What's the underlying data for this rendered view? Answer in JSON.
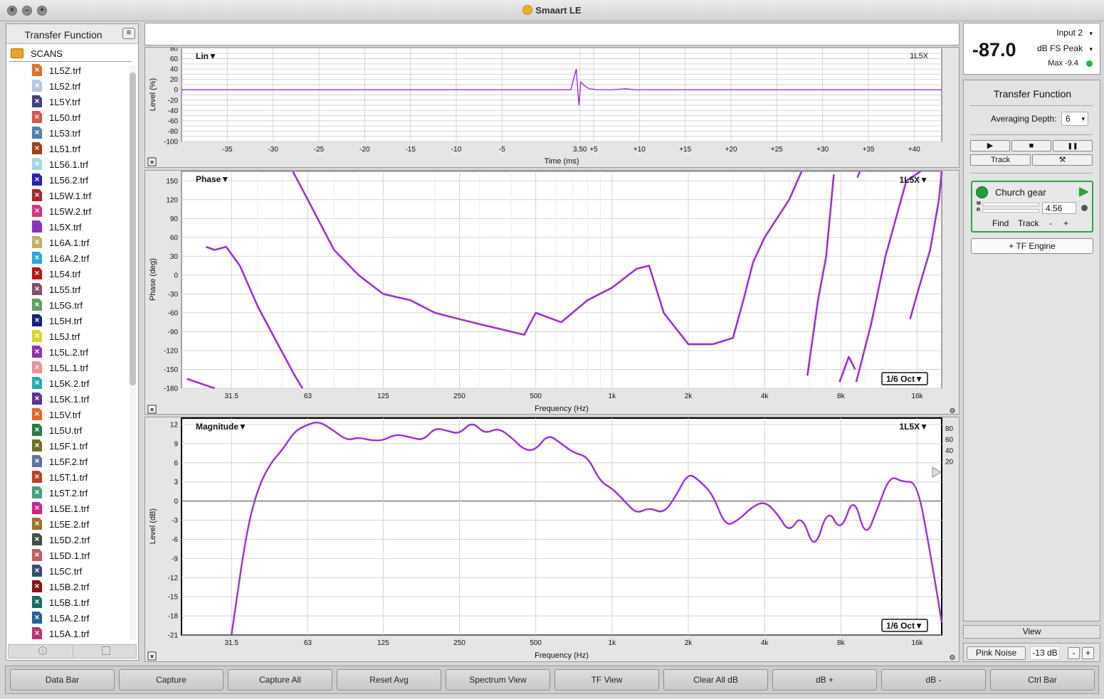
{
  "window": {
    "title": "Smaart LE",
    "close_glyph": "×",
    "minimize_glyph": "–",
    "zoom_glyph": "+"
  },
  "left_panel": {
    "title": "Transfer Function",
    "menu_glyph": "≡",
    "folder": "SCANS",
    "files": [
      {
        "name": "1L5Z.trf",
        "color": "#e07020"
      },
      {
        "name": "1L52.trf",
        "color": "#b8c8e0"
      },
      {
        "name": "1L5Y.trf",
        "color": "#404080"
      },
      {
        "name": "1L50.trf",
        "color": "#e05050"
      },
      {
        "name": "1L53.trf",
        "color": "#5080b0"
      },
      {
        "name": "1L51.trf",
        "color": "#a04010"
      },
      {
        "name": "1L56.1.trf",
        "color": "#a0d8e0"
      },
      {
        "name": "1L56.2.trf",
        "color": "#2020c0"
      },
      {
        "name": "1L5W.1.trf",
        "color": "#b02030"
      },
      {
        "name": "1L5W.2.trf",
        "color": "#e03080"
      },
      {
        "name": "1L5X.trf",
        "color": "#9030c0"
      },
      {
        "name": "1L6A.1.trf",
        "color": "#c0b060"
      },
      {
        "name": "1L6A.2.trf",
        "color": "#20a8e0"
      },
      {
        "name": "1L54.trf",
        "color": "#c01010"
      },
      {
        "name": "1L55.trf",
        "color": "#805070"
      },
      {
        "name": "1L5G.trf",
        "color": "#60a060"
      },
      {
        "name": "1L5H.trf",
        "color": "#102080"
      },
      {
        "name": "1L5J.trf",
        "color": "#d8d820"
      },
      {
        "name": "1L5L.2.trf",
        "color": "#9030b0"
      },
      {
        "name": "1L5L.1.trf",
        "color": "#f09090"
      },
      {
        "name": "1L5K.2.trf",
        "color": "#20b0b0"
      },
      {
        "name": "1L5K.1.trf",
        "color": "#6030a0"
      },
      {
        "name": "1L5V.trf",
        "color": "#f06020"
      },
      {
        "name": "1L5U.trf",
        "color": "#208040"
      },
      {
        "name": "1L5F.1.trf",
        "color": "#707020"
      },
      {
        "name": "1L5F.2.trf",
        "color": "#6070a0"
      },
      {
        "name": "1L5T.1.trf",
        "color": "#c04020"
      },
      {
        "name": "1L5T.2.trf",
        "color": "#40a080"
      },
      {
        "name": "1L5E.1.trf",
        "color": "#d02090"
      },
      {
        "name": "1L5E.2.trf",
        "color": "#a07020"
      },
      {
        "name": "1L5D.2.trf",
        "color": "#405040"
      },
      {
        "name": "1L5D.1.trf",
        "color": "#c06060"
      },
      {
        "name": "1L5C.trf",
        "color": "#305070"
      },
      {
        "name": "1L5B.2.trf",
        "color": "#901010"
      },
      {
        "name": "1L5B.1.trf",
        "color": "#107060"
      },
      {
        "name": "1L5A.2.trf",
        "color": "#2060a0"
      },
      {
        "name": "1L5A.1.trf",
        "color": "#c03070"
      }
    ]
  },
  "colors": {
    "trace": "#9b30d9",
    "plot_bg": "#ffffff",
    "panel_bg": "#e5e5e5",
    "grid": "#d4d4d4",
    "accent_green": "#2da44a"
  },
  "impulse_plot": {
    "header_left": "Lin▼",
    "header_right": "1L5X",
    "ylabel": "Level (%)",
    "xlabel": "Time (ms)",
    "yticks": [
      "80",
      "60",
      "40",
      "20",
      "0",
      "-20",
      "-40",
      "-60",
      "-80",
      "-100"
    ],
    "xticks": [
      "-35",
      "-30",
      "-25",
      "-20",
      "-15",
      "-10",
      "-5",
      "3.50",
      "+5",
      "+10",
      "+15",
      "+20",
      "+25",
      "+30",
      "+35",
      "+40"
    ],
    "close_glyph": "×"
  },
  "phase_plot": {
    "header_left": "Phase▼",
    "header_right": "1L5X▼",
    "ylabel": "Phase (deg)",
    "xlabel": "Frequency (Hz)",
    "yticks": [
      "150",
      "120",
      "90",
      "60",
      "30",
      "0",
      "-30",
      "-60",
      "-90",
      "-120",
      "-150",
      "-180"
    ],
    "xticks": [
      "31.5",
      "63",
      "125",
      "250",
      "500",
      "1k",
      "2k",
      "4k",
      "8k",
      "16k"
    ],
    "smoothing": "1/6 Oct▼",
    "close_glyph": "×",
    "gear_glyph": "⚙"
  },
  "magnitude_plot": {
    "header_left": "Magnitude▼",
    "header_right": "1L5X▼",
    "ylabel": "Level (dB)",
    "xlabel": "Frequency (Hz)",
    "yticks": [
      "12",
      "9",
      "6",
      "3",
      "0",
      "-3",
      "-6",
      "-9",
      "-12",
      "-15",
      "-18",
      "-21"
    ],
    "yticks_right": [
      "80",
      "60",
      "40",
      "20"
    ],
    "xticks": [
      "31.5",
      "63",
      "125",
      "250",
      "500",
      "1k",
      "2k",
      "4k",
      "8k",
      "16k"
    ],
    "smoothing": "1/6 Oct▼",
    "close_glyph": "×",
    "gear_glyph": "⚙"
  },
  "chart_data": [
    {
      "type": "line",
      "title": "Lin",
      "xlabel": "Time (ms)",
      "ylabel": "Level (%)",
      "xlim": [
        -40,
        43
      ],
      "ylim": [
        -100,
        80
      ],
      "series": [
        {
          "name": "1L5X",
          "x": [
            -40,
            -10,
            0,
            2.5,
            2.8,
            3.1,
            3.4,
            3.6,
            4.0,
            4.5,
            5.5,
            7,
            8.5,
            9.5,
            11,
            14,
            20,
            30,
            43
          ],
          "y": [
            0,
            0,
            0,
            0,
            20,
            40,
            -30,
            15,
            8,
            2,
            0,
            0,
            2,
            0,
            0,
            0,
            0,
            0,
            0
          ]
        }
      ]
    },
    {
      "type": "line",
      "title": "Phase",
      "xlabel": "Frequency (Hz)",
      "ylabel": "Phase (deg)",
      "x_scale": "log",
      "ylim": [
        -180,
        165
      ],
      "series": [
        {
          "name": "1L5X",
          "segments": [
            {
              "x": [
                21,
                27
              ],
              "y": [
                -165,
                -180
              ]
            },
            {
              "x": [
                25,
                27,
                30,
                34,
                40,
                48,
                56,
                60
              ],
              "y": [
                45,
                40,
                45,
                15,
                -50,
                -110,
                -160,
                -180
              ]
            },
            {
              "x": [
                55,
                63,
                80,
                100,
                125,
                160,
                200,
                250,
                315,
                400,
                450,
                500,
                630,
                800,
                1000,
                1250,
                1400,
                1600,
                2000,
                2500,
                3000,
                3300,
                3600,
                4000,
                5000,
                5600
              ],
              "y": [
                170,
                120,
                40,
                0,
                -30,
                -40,
                -60,
                -70,
                -80,
                -90,
                -95,
                -60,
                -75,
                -40,
                -20,
                10,
                15,
                -60,
                -110,
                -110,
                -100,
                -40,
                20,
                60,
                120,
                170
              ]
            },
            {
              "x": [
                5900,
                6500,
                7000,
                7500
              ],
              "y": [
                -160,
                -40,
                30,
                160
              ]
            },
            {
              "x": [
                7900,
                8600,
                9100
              ],
              "y": [
                -170,
                -130,
                -150
              ]
            },
            {
              "x": [
                9300,
                9500
              ],
              "y": [
                155,
                165
              ]
            },
            {
              "x": [
                9200,
                10500,
                12000,
                14500,
                16500
              ],
              "y": [
                -170,
                -80,
                30,
                150,
                170
              ]
            },
            {
              "x": [
                15000,
                16000,
                18000,
                19500,
                20000
              ],
              "y": [
                -70,
                -30,
                40,
                120,
                165
              ]
            }
          ]
        }
      ]
    },
    {
      "type": "line",
      "title": "Magnitude",
      "xlabel": "Frequency (Hz)",
      "ylabel": "Level (dB)",
      "x_scale": "log",
      "ylim": [
        -21,
        13
      ],
      "series": [
        {
          "name": "1L5X",
          "x": [
            31.5,
            36,
            40,
            45,
            50,
            56,
            63,
            70,
            80,
            90,
            100,
            112,
            125,
            140,
            160,
            180,
            200,
            224,
            250,
            280,
            315,
            355,
            400,
            450,
            500,
            560,
            630,
            710,
            800,
            900,
            1000,
            1120,
            1250,
            1400,
            1600,
            1800,
            2000,
            2240,
            2500,
            2800,
            3150,
            3550,
            4000,
            4500,
            5000,
            5600,
            6300,
            7100,
            8000,
            9000,
            10000,
            11200,
            12500,
            14000,
            16000,
            18000,
            20000
          ],
          "y": [
            -21,
            -5,
            2,
            6,
            8,
            11,
            12,
            12.5,
            11,
            9.5,
            10,
            9.5,
            9.5,
            10.5,
            10,
            9.5,
            11.5,
            11,
            10.5,
            12.5,
            10.5,
            11.5,
            10,
            8,
            8,
            10.5,
            9,
            7.5,
            7,
            3,
            2,
            0,
            -2,
            -1,
            -2,
            1,
            4.5,
            3,
            1,
            -4,
            -3,
            -1,
            0,
            -2,
            -5,
            -2,
            -8,
            -1,
            -5,
            1,
            -6,
            -1,
            4,
            3,
            3,
            -8,
            -19
          ]
        }
      ]
    }
  ],
  "meter": {
    "value": "-87.0",
    "input": "Input 2",
    "mode": "dB FS Peak",
    "max": "Max -9.4",
    "chevron": "▾"
  },
  "right_panel": {
    "title": "Transfer Function",
    "averaging_label": "Averaging Depth:",
    "averaging_value": "6",
    "play_glyph": "▶",
    "stop_glyph": "■",
    "pause_glyph": "❚❚",
    "track_label": "Track",
    "tools_glyph": "⚒",
    "engine": {
      "name": "Church gear",
      "delay": "4.56",
      "m_label": "M",
      "r_label": "R",
      "find_label": "Find",
      "track_label": "Track",
      "minus_label": "-",
      "plus_label": "+"
    },
    "add_engine_label": "+ TF Engine"
  },
  "view_label": "View",
  "pink_noise": {
    "label": "Pink Noise",
    "level": "-13 dB",
    "minus": "-",
    "plus": "+"
  },
  "bottom_buttons": [
    "Data Bar",
    "Capture",
    "Capture All",
    "Reset Avg",
    "Spectrum View",
    "TF View",
    "Clear All dB",
    "dB +",
    "dB -",
    "Ctrl Bar"
  ]
}
